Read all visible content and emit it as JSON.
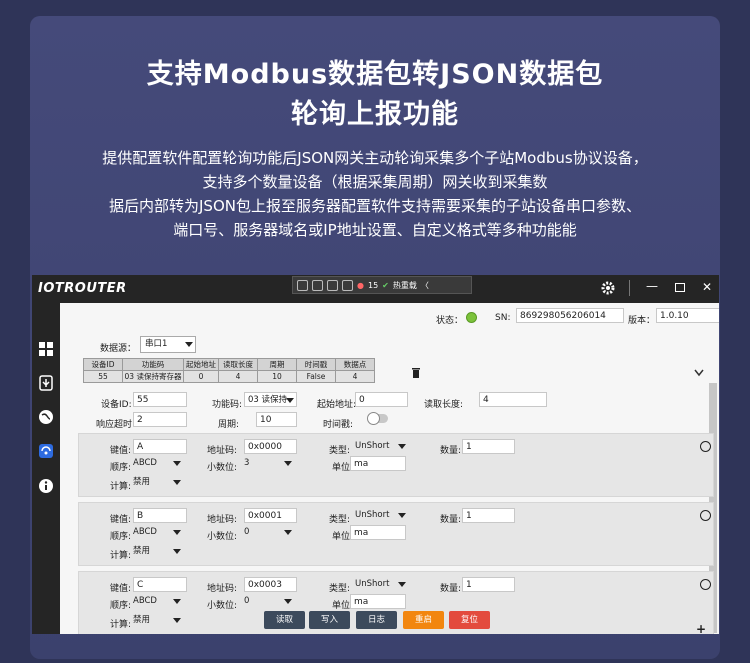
{
  "hero": {
    "title_line1": "支持Modbus数据包转JSON数据包",
    "title_line2": "轮询上报功能",
    "desc_line1": "提供配置软件配置轮询功能后JSON网关主动轮询采集多个子站Modbus协议设备，",
    "desc_line2": "支持多个数量设备（根据采集周期）网关收到采集数",
    "desc_line3": "据后内部转为JSON包上报至服务器配置软件支持需要采集的子站设备串口参数、",
    "desc_line4": "端口号、服务器域名或IP地址设置、自定义格式等多种功能能"
  },
  "app": {
    "logo": "IOTROUTER",
    "toolstrip": {
      "badge": "15",
      "hotreload": "热重载",
      "chevron": "〈"
    },
    "status_label": "状态：",
    "sn_label": "SN:",
    "sn_value": "869298056206014",
    "version_label": "版本：",
    "version_value": "1.0.10",
    "source_label": "数据源：",
    "source_value": "串口1",
    "table": {
      "headers": [
        "设备ID",
        "功能码",
        "起始地址",
        "读取长度",
        "周期",
        "时间戳",
        "数据点"
      ],
      "row": [
        "55",
        "03 读保持寄存器",
        "0",
        "4",
        "10",
        "False",
        "4"
      ]
    },
    "device": {
      "id_label": "设备ID:",
      "id_value": "55",
      "func_label": "功能码:",
      "func_value": "03 读保持",
      "start_label": "起始地址:",
      "start_value": "0",
      "len_label": "读取长度:",
      "len_value": "4",
      "timeout_label": "响应超时:",
      "timeout_value": "2",
      "period_label": "周期:",
      "period_value": "10",
      "ts_label": "时间戳:"
    },
    "point_labels": {
      "key": "键值:",
      "addr": "地址码:",
      "type": "类型:",
      "count": "数量:",
      "order": "顺序:",
      "decimal": "小数位:",
      "unit": "单位",
      "calc": "计算:"
    },
    "points": [
      {
        "key": "A",
        "addr": "0x0000",
        "type": "UnShort",
        "count": "1",
        "order": "ABCD",
        "decimal": "3",
        "unit": "ma",
        "calc": "禁用"
      },
      {
        "key": "B",
        "addr": "0x0001",
        "type": "UnShort",
        "count": "1",
        "order": "ABCD",
        "decimal": "0",
        "unit": "ma",
        "calc": "禁用"
      },
      {
        "key": "C",
        "addr": "0x0003",
        "type": "UnShort",
        "count": "1",
        "order": "ABCD",
        "decimal": "0",
        "unit": "ma",
        "calc": "禁用"
      }
    ],
    "buttons": {
      "read": "读取",
      "write": "写入",
      "log": "日志",
      "restart": "重启",
      "reset": "复位"
    },
    "colors": {
      "status_ok": "#7cc23b",
      "btn_dark": "#3c4a5c",
      "btn_orange": "#f2860f",
      "btn_red": "#e34b3e"
    }
  }
}
